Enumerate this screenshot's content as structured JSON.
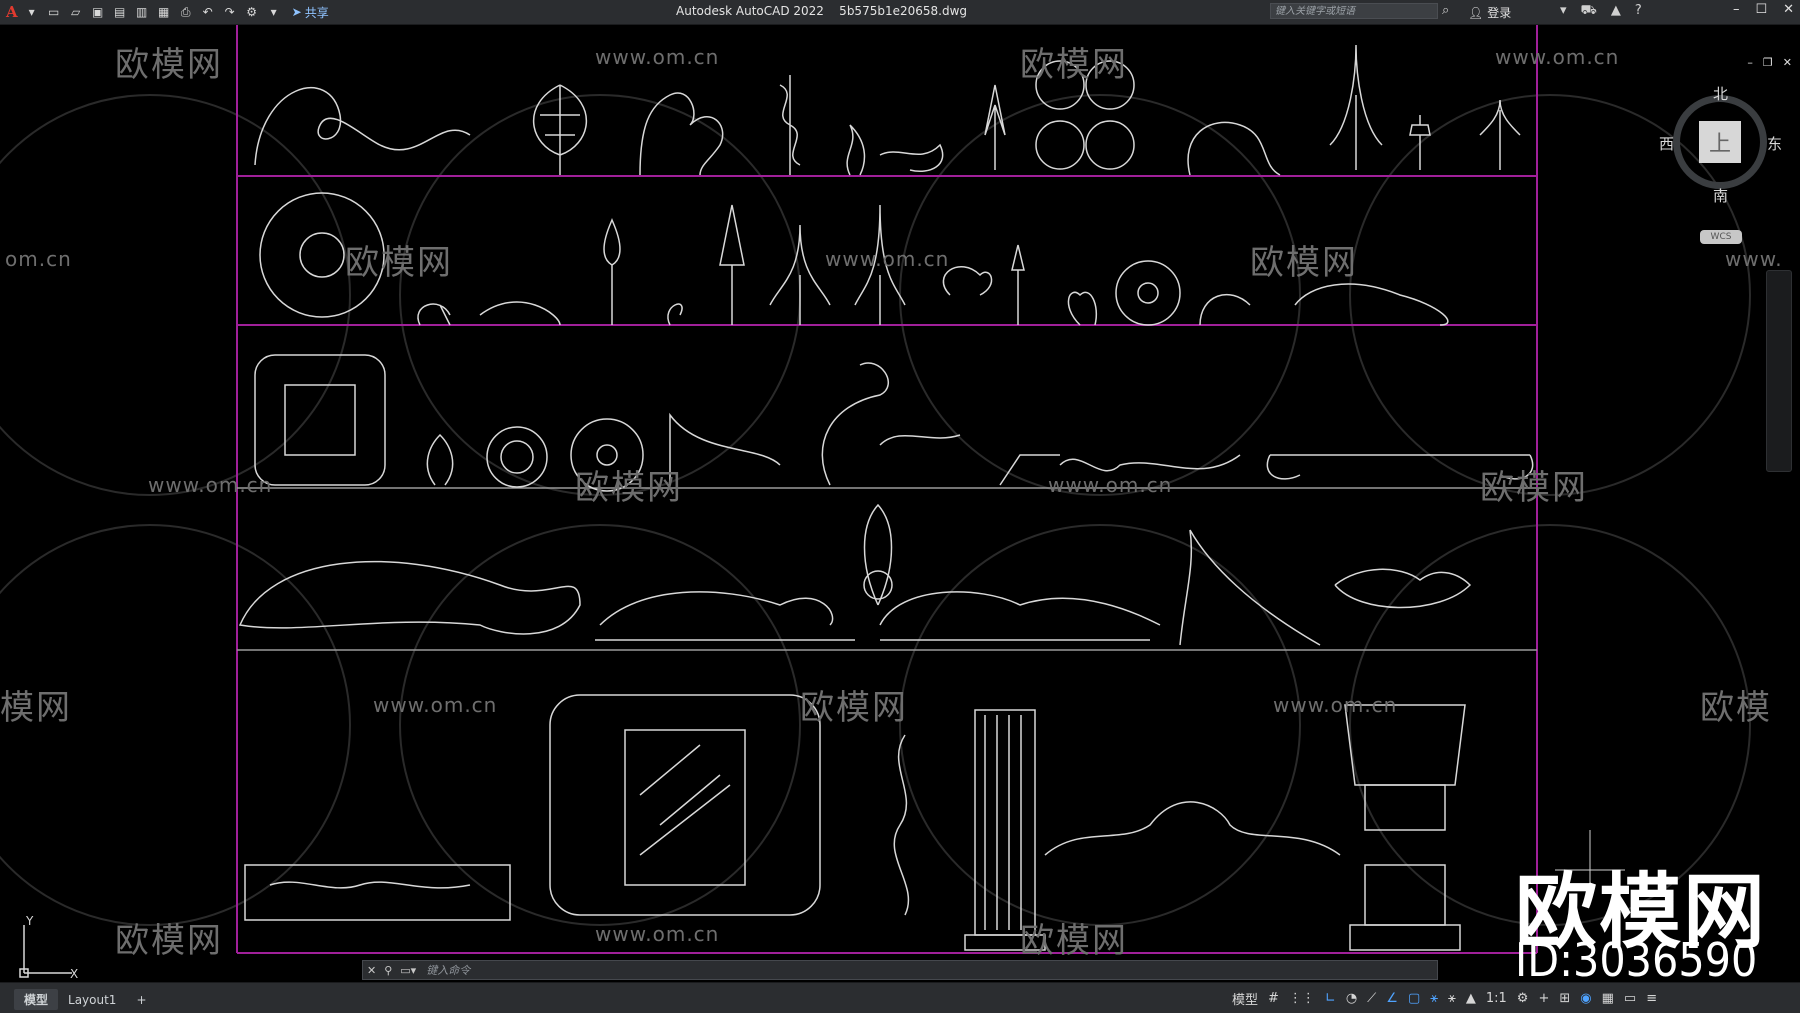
{
  "app": {
    "logo": "A",
    "title": "Autodesk AutoCAD 2022    5b575b1e20658.dwg",
    "share_label": "共享",
    "search_placeholder": "键入关键字或短语",
    "login_label": "登录"
  },
  "quick_access": [
    "new-icon",
    "open-icon",
    "save-icon",
    "save-as-icon",
    "plot-icon",
    "undo-icon",
    "redo-icon",
    "share-icon"
  ],
  "viewcube": {
    "north": "北",
    "south": "南",
    "west": "西",
    "east": "东",
    "face": "上",
    "wcs": "WCS"
  },
  "watermarks": {
    "brand": "欧模网",
    "url": "www.om.cn",
    "url_partial_left": "om.cn",
    "url_partial_right": "www.",
    "brand_partial_left": "模网",
    "brand_partial_right": "欧模"
  },
  "overlay": {
    "brand": "欧模网",
    "id_text": "ID:3036590"
  },
  "ucs": {
    "x": "X",
    "y": "Y"
  },
  "command": {
    "placeholder": "键入命令"
  },
  "status": {
    "tabs": [
      "模型",
      "Layout1",
      "+"
    ],
    "model_label": "模型",
    "scale": "1:1"
  },
  "colors": {
    "frame_lines": "#a0209a",
    "drawing_lines": "#d8d8d8",
    "background": "#000000"
  }
}
